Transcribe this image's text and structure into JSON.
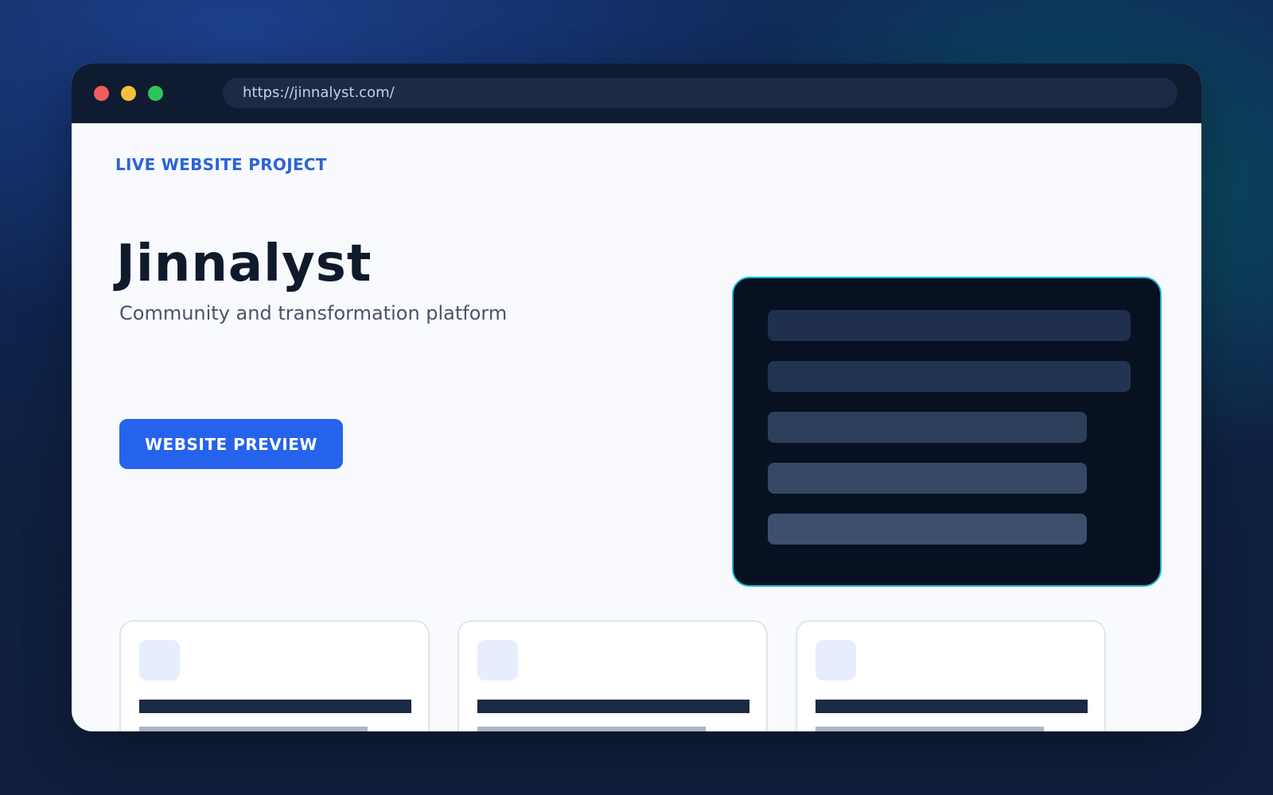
{
  "browser": {
    "url": "https://jinnalyst.com/"
  },
  "hero": {
    "eyebrow": "LIVE WEBSITE PROJECT",
    "title": "Jinnalyst",
    "subtitle": "Community and transformation platform",
    "cta_label": "WEBSITE PREVIEW"
  },
  "colors": {
    "accent": "#2663ec",
    "mockup_border": "#18b6d1",
    "titlebar": "#0f1b31"
  }
}
